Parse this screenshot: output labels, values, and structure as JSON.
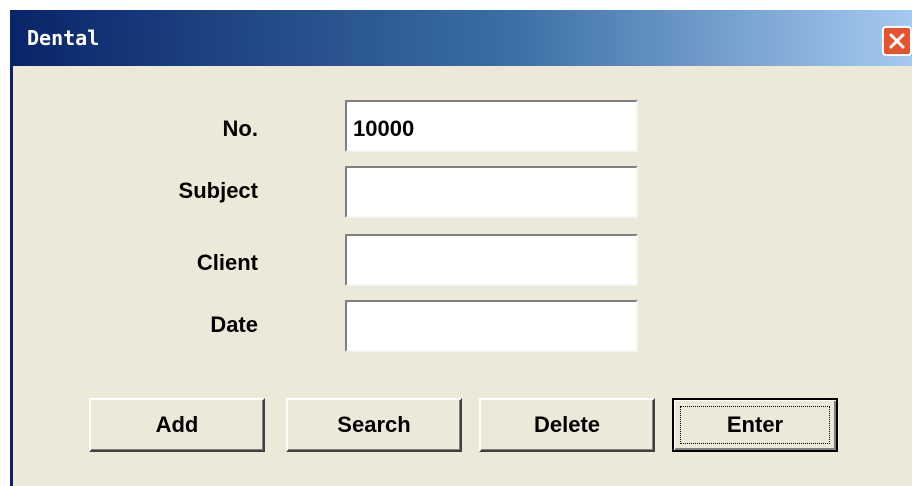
{
  "window": {
    "title": "Dental"
  },
  "titlebar": {
    "close_icon": "close-icon",
    "close_color": "#e5532f"
  },
  "form": {
    "no_label": "No.",
    "no_value": "10000",
    "subject_label": "Subject",
    "subject_value": "",
    "client_label": "Client",
    "client_value": "",
    "date_label": "Date",
    "date_value": ""
  },
  "buttons": {
    "add": "Add",
    "search": "Search",
    "delete": "Delete",
    "enter": "Enter"
  }
}
